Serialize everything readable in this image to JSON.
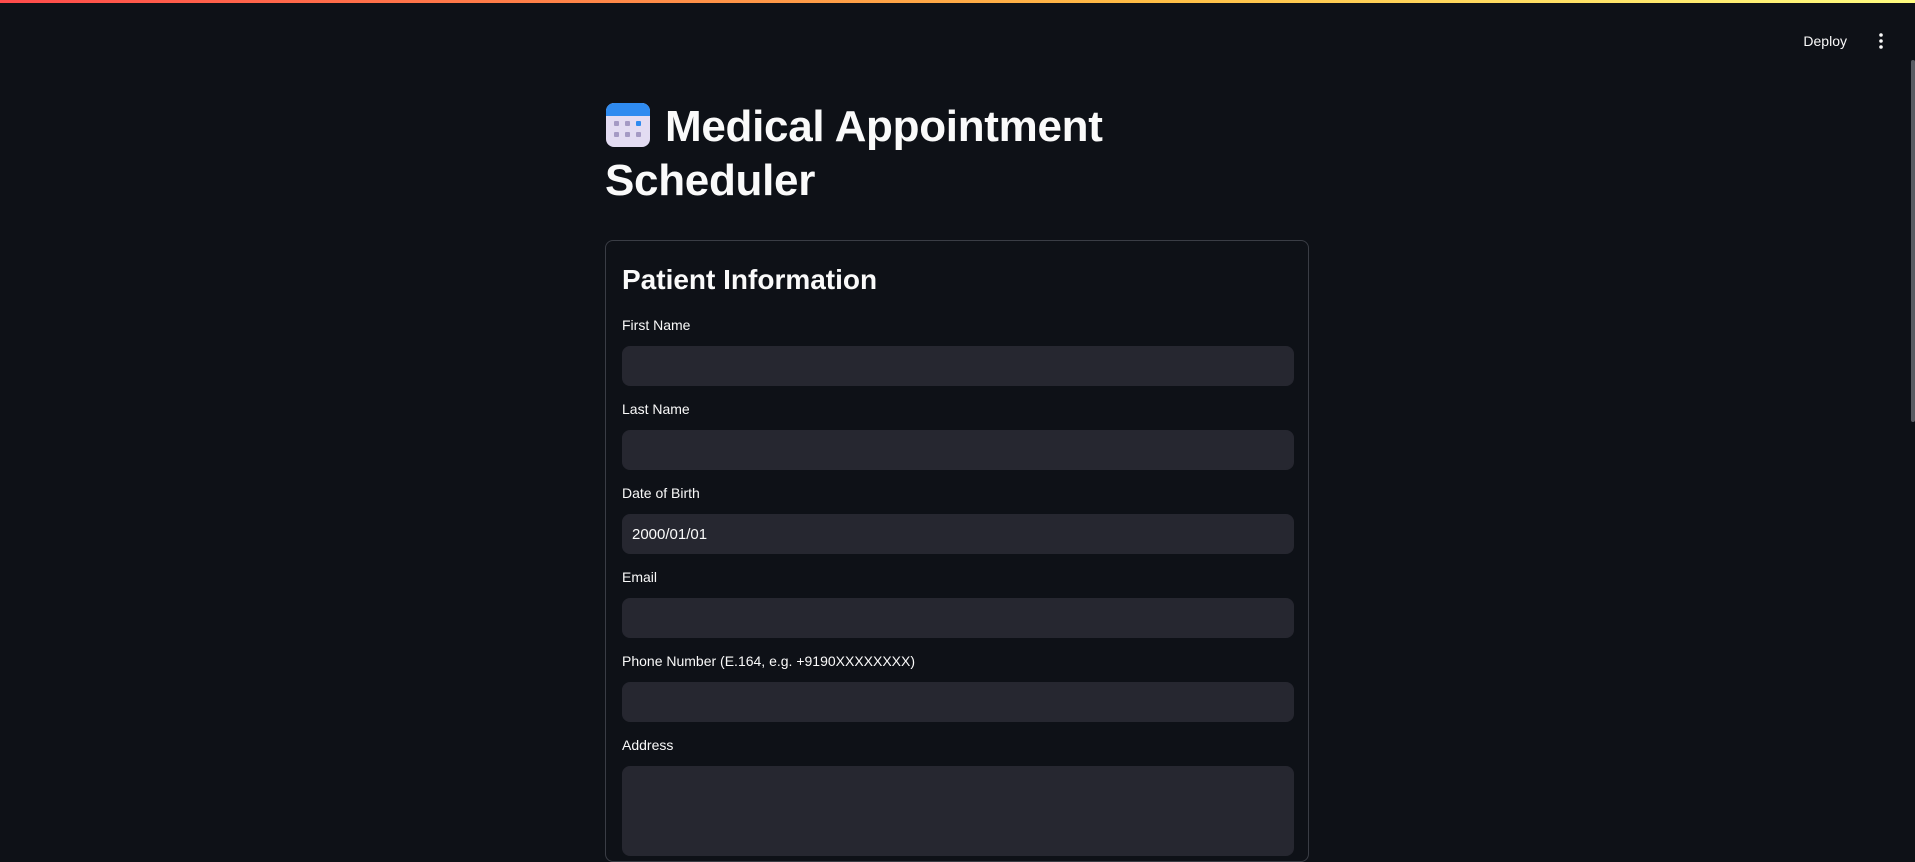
{
  "header": {
    "deploy_label": "Deploy",
    "menu_icon": "vertical-ellipsis-icon"
  },
  "page": {
    "title_icon": "calendar-icon",
    "title": "Medical Appointment Scheduler"
  },
  "form": {
    "heading": "Patient Information",
    "fields": [
      {
        "label": "First Name",
        "value": "",
        "type": "text"
      },
      {
        "label": "Last Name",
        "value": "",
        "type": "text"
      },
      {
        "label": "Date of Birth",
        "value": "2000/01/01",
        "type": "date"
      },
      {
        "label": "Email",
        "value": "",
        "type": "text"
      },
      {
        "label": "Phone Number (E.164, e.g. +9190XXXXXXXX)",
        "value": "",
        "type": "text"
      },
      {
        "label": "Address",
        "value": "",
        "type": "textarea"
      }
    ]
  },
  "colors": {
    "background": "#0e1117",
    "input_background": "#262730",
    "text": "#fafafa",
    "border": "#3a3d45",
    "accent_gradient_start": "#ff4b4b",
    "accent_gradient_end": "#fffd80"
  }
}
